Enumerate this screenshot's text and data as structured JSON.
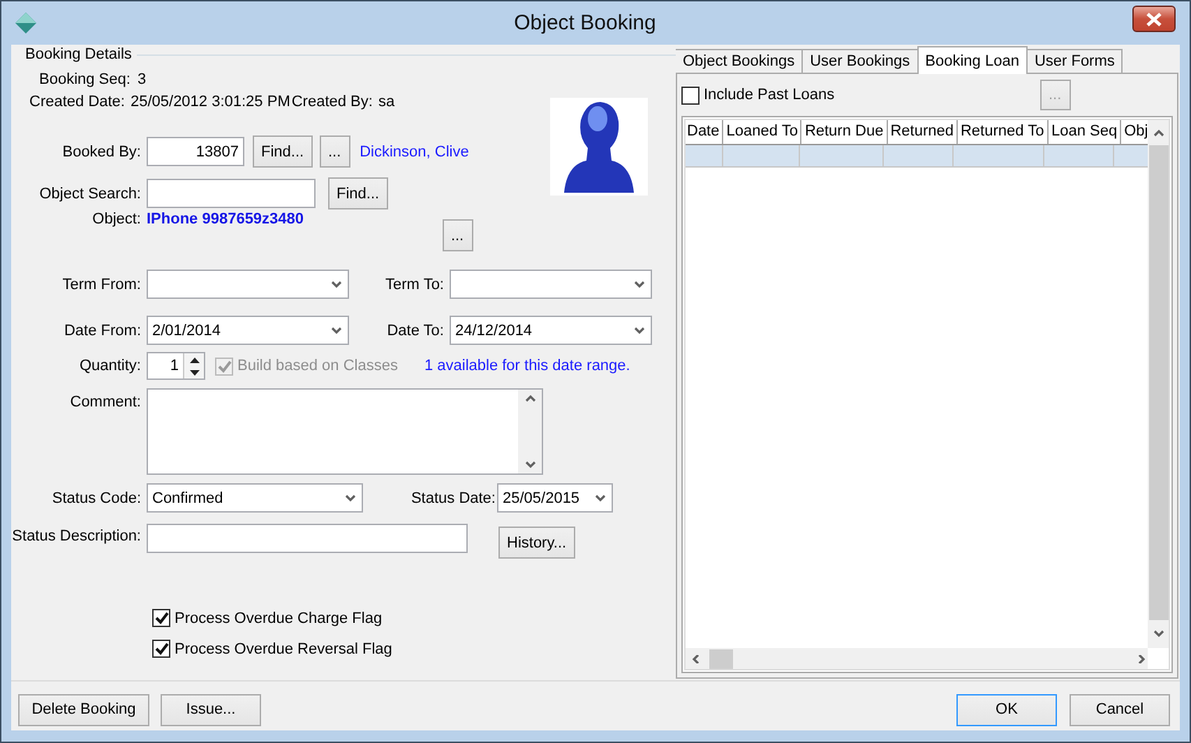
{
  "window": {
    "title": "Object Booking"
  },
  "details": {
    "group_title": "Booking Details",
    "booking_seq": {
      "label": "Booking Seq:",
      "value": "3"
    },
    "created": {
      "label": "Created Date:",
      "value": "25/05/2012 3:01:25 PM",
      "by_label": "Created By:",
      "by_value": "sa"
    },
    "booked_by": {
      "label": "Booked By:",
      "value": "13807",
      "find_button": "Find...",
      "more_button": "...",
      "name": "Dickinson, Clive"
    },
    "object_search": {
      "label": "Object Search:",
      "find_button": "Find..."
    },
    "object": {
      "label": "Object:",
      "value": "IPhone 9987659z3480",
      "more_button": "..."
    },
    "term_from": {
      "label": "Term From:"
    },
    "term_to": {
      "label": "Term To:"
    },
    "date_from": {
      "label": "Date From:",
      "value": "2/01/2014"
    },
    "date_to": {
      "label": "Date To:",
      "value": "24/12/2014"
    },
    "quantity": {
      "label": "Quantity:",
      "value": "1"
    },
    "build_classes": {
      "label": "Build based on Classes",
      "checked": true,
      "disabled": true
    },
    "availability": "1 available for this date range.",
    "comment": {
      "label": "Comment:"
    },
    "status_code": {
      "label": "Status Code:",
      "value": "Confirmed"
    },
    "status_date": {
      "label": "Status Date:",
      "value": "25/05/2015"
    },
    "status_description": {
      "label": "Status Description:",
      "history_button": "History..."
    },
    "flags": [
      {
        "label": "Process Overdue Charge Flag",
        "checked": true
      },
      {
        "label": "Process Overdue Reversal Flag",
        "checked": true
      }
    ]
  },
  "tabs": [
    {
      "label": "Object Bookings",
      "selected": false
    },
    {
      "label": "User Bookings",
      "selected": false
    },
    {
      "label": "Booking Loan",
      "selected": true
    },
    {
      "label": "User Forms",
      "selected": false
    }
  ],
  "loans": {
    "include_past": {
      "label": "Include Past Loans",
      "checked": false
    },
    "more_button": {
      "label": "...",
      "disabled": true
    },
    "table": {
      "columns": [
        "Date",
        "Loaned To",
        "Return Due",
        "Returned",
        "Returned To",
        "Loan Seq",
        "Obj"
      ],
      "rows": [
        {
          "selected": true
        }
      ]
    }
  },
  "buttons": {
    "left": [
      "Delete Booking",
      "Issue..."
    ],
    "right": [
      {
        "label": "OK",
        "default": true
      },
      {
        "label": "Cancel",
        "default": false
      }
    ]
  }
}
